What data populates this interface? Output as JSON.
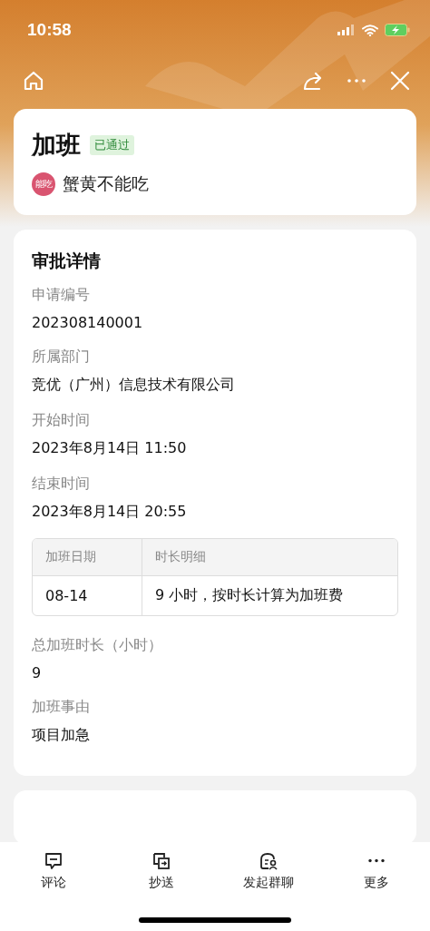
{
  "status_bar": {
    "time": "10:58"
  },
  "header": {
    "title": "加班",
    "status": "已通过",
    "applicant": {
      "avatar_text": "能吃",
      "name": "蟹黄不能吃"
    }
  },
  "details": {
    "title": "审批详情",
    "fields": [
      {
        "label": "申请编号",
        "value": "202308140001"
      },
      {
        "label": "所属部门",
        "value": "竞优（广州）信息技术有限公司"
      },
      {
        "label": "开始时间",
        "value": "2023年8月14日 11:50"
      },
      {
        "label": "结束时间",
        "value": "2023年8月14日 20:55"
      }
    ],
    "table": {
      "columns": [
        "加班日期",
        "时长明细"
      ],
      "rows": [
        [
          "08-14",
          "9 小时，按时长计算为加班费"
        ]
      ]
    },
    "fields_after": [
      {
        "label": "总加班时长（小时）",
        "value": "9"
      },
      {
        "label": "加班事由",
        "value": "项目加急"
      }
    ]
  },
  "toolbar": [
    {
      "label": "评论",
      "kind": "comment"
    },
    {
      "label": "抄送",
      "kind": "copy"
    },
    {
      "label": "发起群聊",
      "kind": "chat"
    },
    {
      "label": "更多",
      "kind": "more"
    }
  ]
}
